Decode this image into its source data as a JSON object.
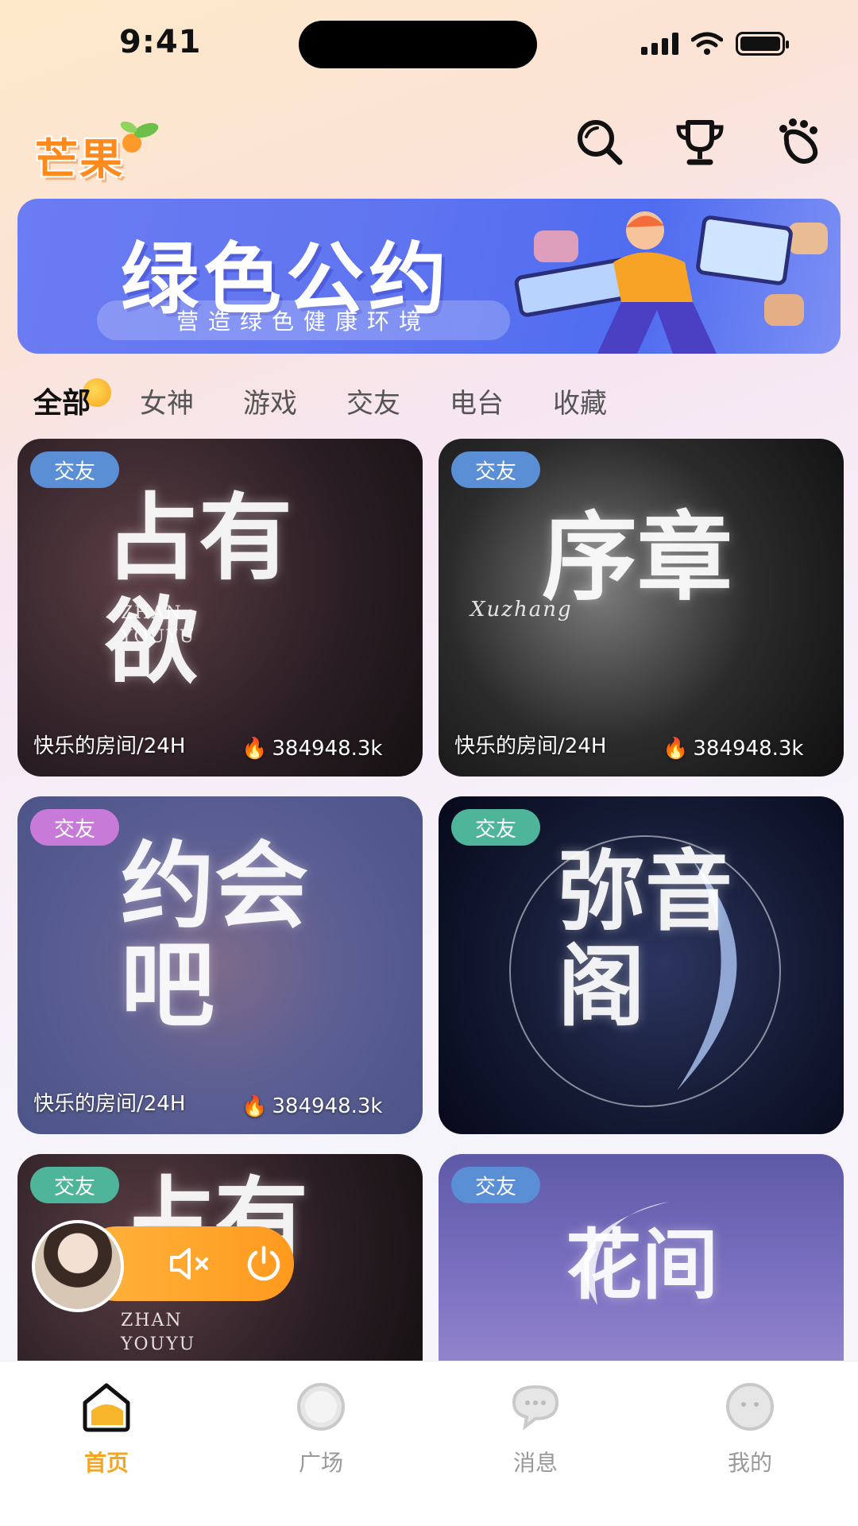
{
  "status_bar": {
    "time": "9:41"
  },
  "header": {
    "logo_text": "芒果",
    "icons": [
      "search-icon",
      "trophy-icon",
      "footprint-icon"
    ]
  },
  "banner": {
    "title": "绿色公约",
    "subtitle": "营造绿色健康环境"
  },
  "tabs": [
    {
      "label": "全部",
      "active": true
    },
    {
      "label": "女神"
    },
    {
      "label": "游戏"
    },
    {
      "label": "交友"
    },
    {
      "label": "电台"
    },
    {
      "label": "收藏"
    }
  ],
  "rooms": [
    {
      "badge": "交友",
      "badge_color": "#5a8fd6",
      "art_text": "占有欲",
      "art_sub": "ZHAN YOUYU",
      "room_name": "快乐的房间/24H",
      "heat": "384948.3k"
    },
    {
      "badge": "交友",
      "badge_color": "#5a8fd6",
      "art_text": "序章",
      "art_sub": "Xuzhang",
      "room_name": "快乐的房间/24H",
      "heat": "384948.3k"
    },
    {
      "badge": "交友",
      "badge_color": "#c77ad8",
      "art_text": "约会吧",
      "room_name": "快乐的房间/24H",
      "heat": "384948.3k"
    },
    {
      "badge": "交友",
      "badge_color": "#4fb59a",
      "art_text": "弥音阁"
    },
    {
      "badge": "交友",
      "badge_color": "#4fb59a",
      "art_text": "占有",
      "art_sub": "ZHAN YOUYU"
    },
    {
      "badge": "交友",
      "badge_color": "#5a8fd6",
      "art_text": "花间"
    }
  ],
  "player": {
    "icons": [
      "mute-icon",
      "power-icon"
    ]
  },
  "bottom_nav": [
    {
      "label": "首页",
      "icon": "home-icon",
      "active": true
    },
    {
      "label": "广场",
      "icon": "plaza-icon"
    },
    {
      "label": "消息",
      "icon": "message-icon"
    },
    {
      "label": "我的",
      "icon": "profile-icon"
    }
  ],
  "colors": {
    "accent": "#f4a623",
    "banner_blue": "#5f74f0",
    "player_orange": "#ff9a1e"
  }
}
